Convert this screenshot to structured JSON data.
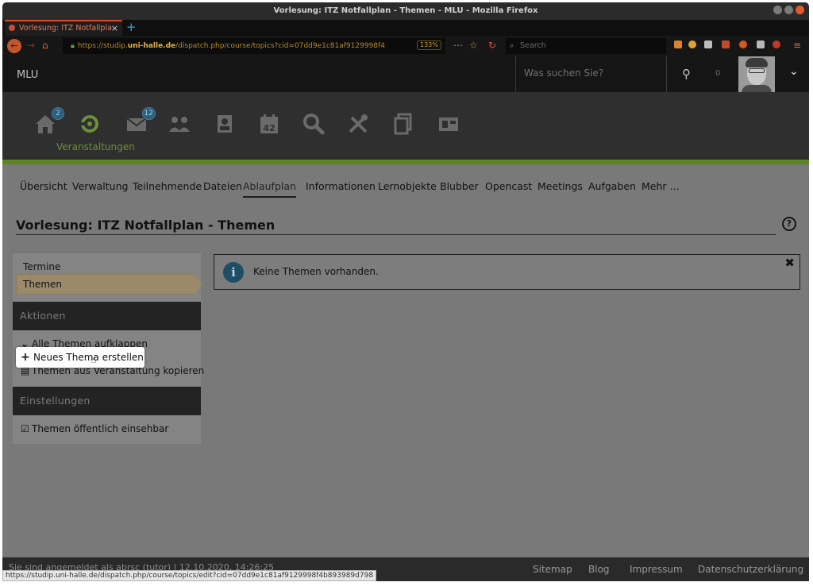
{
  "window": {
    "title": "Vorlesung: ITZ Notfallplan - Themen - MLU - Mozilla Firefox"
  },
  "browser": {
    "tab_title": "Vorlesung: ITZ Notfallpla",
    "url_prefix": "https://studip.",
    "url_domain": "uni-halle.de",
    "url_path": "/dispatch.php/course/topics?cid=07dd9e1c81af9129998f4",
    "zoom": "133%",
    "search_placeholder": "Search"
  },
  "header": {
    "site_name": "MLU",
    "search_placeholder": "Was suchen Sie?",
    "counter": "0"
  },
  "main_nav": {
    "active_label": "Veranstaltungen",
    "home_badge": "2",
    "messages_badge": "12",
    "schedule_day": "42"
  },
  "subnav": {
    "items": [
      "Übersicht",
      "Verwaltung",
      "Teilnehmende",
      "Dateien",
      "Ablaufplan",
      "Informationen",
      "Lernobjekte",
      "Blubber",
      "Opencast",
      "Meetings",
      "Aufgaben",
      "Mehr …"
    ],
    "active": "Ablaufplan"
  },
  "page": {
    "title": "Vorlesung: ITZ Notfallplan - Themen",
    "help": "?"
  },
  "sidebar": {
    "links": [
      "Termine",
      "Themen"
    ],
    "active_link": "Themen",
    "actions_heading": "Aktionen",
    "actions": [
      "Alle Themen aufklappen",
      "Neues Thema erstellen",
      "Themen aus Veranstaltung kopieren"
    ],
    "settings_heading": "Einstellungen",
    "settings": [
      "Themen öffentlich einsehbar"
    ]
  },
  "message": {
    "icon": "i",
    "text": "Keine Themen vorhanden.",
    "close": "✖"
  },
  "footer": {
    "login_info": "Sie sind angemeldet als abrsc (tutor) | 12.10.2020, 14:26:25",
    "links": [
      "Sitemap",
      "Blog",
      "Impressum",
      "Datenschutzerklärung"
    ]
  },
  "statusbar": {
    "url": "https://studip.uni-halle.de/dispatch.php/course/topics/edit?cid=07dd9e1c81af9129998f4b893989d798"
  },
  "colors": {
    "accent_green": "#5e8524",
    "firefox_orange": "#d94c2a",
    "badge_blue": "#2b5f7d"
  }
}
